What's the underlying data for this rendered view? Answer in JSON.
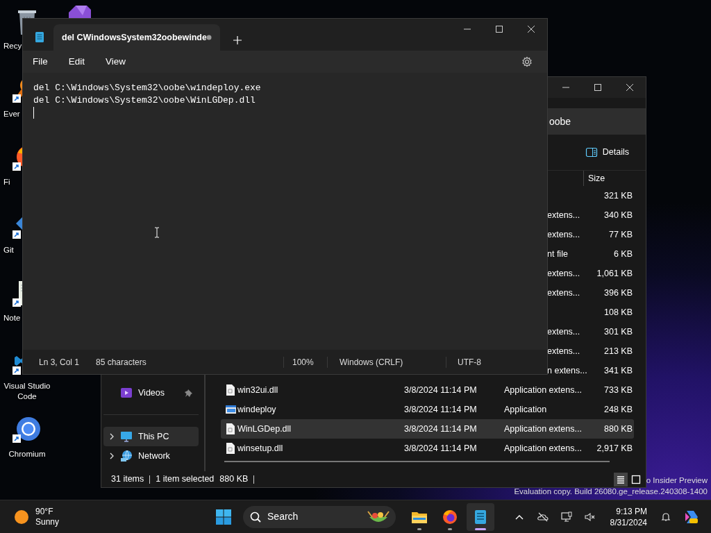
{
  "desktop": {
    "icons": [
      {
        "kind": "recycle",
        "label": "Recy",
        "shortcut": false
      },
      {
        "kind": "everything",
        "label": "Ever",
        "shortcut": true
      },
      {
        "kind": "firefox",
        "label": "Fi",
        "shortcut": true
      },
      {
        "kind": "git",
        "label": "Git",
        "shortcut": true
      },
      {
        "kind": "notepadpp",
        "label": "Note",
        "shortcut": true
      },
      {
        "kind": "vscode",
        "label": "Visual Studio Code",
        "shortcut": true
      },
      {
        "kind": "chromium",
        "label": "Chromium",
        "shortcut": true
      }
    ],
    "notice": [
      "o Insider Preview",
      "Evaluation copy. Build 26080.ge_release.240308-1400"
    ]
  },
  "explorer": {
    "address": "oobe",
    "details_button": "Details",
    "size_header": "Size",
    "partial_rows": [
      {
        "size": "321 KB"
      },
      {
        "type": "extens...",
        "size": "340 KB"
      },
      {
        "type": "extens...",
        "size": "77 KB"
      },
      {
        "type": "nt file",
        "size": "6 KB"
      },
      {
        "type": "extens...",
        "size": "1,061 KB"
      },
      {
        "type": "extens...",
        "size": "396 KB"
      },
      {
        "size": "108 KB"
      },
      {
        "type": "extens...",
        "size": "301 KB"
      },
      {
        "type": "extens...",
        "size": "213 KB"
      },
      {
        "type": "n extens...",
        "size": "341 KB"
      }
    ],
    "rows": [
      {
        "kind": "dll",
        "name": "win32ui.dll",
        "date": "3/8/2024 11:14 PM",
        "type": "Application extens...",
        "size": "733 KB",
        "selected": false
      },
      {
        "kind": "exe",
        "name": "windeploy",
        "date": "3/8/2024 11:14 PM",
        "type": "Application",
        "size": "248 KB",
        "selected": false
      },
      {
        "kind": "dll",
        "name": "WinLGDep.dll",
        "date": "3/8/2024 11:14 PM",
        "type": "Application extens...",
        "size": "880 KB",
        "selected": true
      },
      {
        "kind": "dll",
        "name": "winsetup.dll",
        "date": "3/8/2024 11:14 PM",
        "type": "Application extens...",
        "size": "2,917 KB",
        "selected": false
      }
    ],
    "sidebar": [
      {
        "kind": "videos",
        "label": "Videos",
        "pinned": true,
        "expandable": false,
        "selected": false
      },
      {
        "kind": "pc",
        "label": "This PC",
        "pinned": false,
        "expandable": true,
        "selected": true
      },
      {
        "kind": "network",
        "label": "Network",
        "pinned": false,
        "expandable": true,
        "selected": false
      }
    ],
    "status": {
      "count": "31 items",
      "selection": "1 item selected",
      "selection_size": "880 KB"
    },
    "views": [
      {
        "kind": "details",
        "selected": true
      },
      {
        "kind": "tiles",
        "selected": false
      }
    ]
  },
  "notepad": {
    "tabs": [
      {
        "title": "del CWindowsSystem32oobewinde",
        "modified": true,
        "selected": true
      }
    ],
    "menu": [
      "File",
      "Edit",
      "View"
    ],
    "lines": [
      "del C:\\Windows\\System32\\oobe\\windeploy.exe",
      "del C:\\Windows\\System32\\oobe\\WinLGDep.dll"
    ],
    "status": {
      "position": "Ln 3, Col 1",
      "characters": "85 characters",
      "zoom": "100%",
      "line_ending": "Windows (CRLF)",
      "encoding": "UTF-8"
    }
  },
  "taskbar": {
    "weather": {
      "temperature": "90°F",
      "condition": "Sunny"
    },
    "search": "Search",
    "apps": [
      {
        "kind": "explorer",
        "running": true,
        "selected": false
      },
      {
        "kind": "firefox",
        "running": true,
        "selected": false
      },
      {
        "kind": "notepad",
        "running": true,
        "selected": true
      }
    ],
    "clock": {
      "time": "9:13 PM",
      "date": "8/31/2024"
    }
  }
}
